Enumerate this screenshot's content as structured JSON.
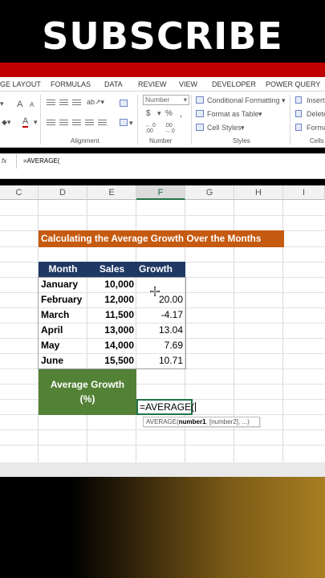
{
  "banner": {
    "title": "SUBSCRIBE"
  },
  "ribbon_tabs": [
    "GE LAYOUT",
    "FORMULAS",
    "DATA",
    "REVIEW",
    "VIEW",
    "DEVELOPER",
    "POWER QUERY"
  ],
  "ribbon": {
    "groups": [
      "Alignment",
      "Number",
      "Styles",
      "Cells"
    ],
    "number_format": "Number",
    "conditional_formatting": "Conditional Formatting",
    "format_as_table": "Format as Table",
    "cell_styles": "Cell Styles",
    "insert": "Insert",
    "delete": "Delete",
    "format": "Format",
    "currency": "$",
    "percent": "%",
    "comma": ",",
    "font_grow": "A",
    "font_shrink": "A",
    "font_color": "A"
  },
  "formula_bar": {
    "fx": "fx",
    "value": "=AVERAGE("
  },
  "columns": [
    "C",
    "D",
    "E",
    "F",
    "G",
    "H",
    "I"
  ],
  "sheet": {
    "title": "Calculating the Average Growth Over the Months",
    "headers": [
      "Month",
      "Sales",
      "Growth"
    ],
    "rows": [
      {
        "month": "January",
        "sales": "10,000",
        "growth": ""
      },
      {
        "month": "February",
        "sales": "12,000",
        "growth": "20.00"
      },
      {
        "month": "March",
        "sales": "11,500",
        "growth": "-4.17"
      },
      {
        "month": "April",
        "sales": "13,000",
        "growth": "13.04"
      },
      {
        "month": "May",
        "sales": "14,000",
        "growth": "7.69"
      },
      {
        "month": "June",
        "sales": "15,500",
        "growth": "10.71"
      }
    ],
    "avg_label_line1": "Average Growth",
    "avg_label_line2": "(%)",
    "editing_value": "=AVERAGE(",
    "tooltip_fn": "AVERAGE(",
    "tooltip_arg1": "number1",
    "tooltip_rest": ", [number2], ...)"
  }
}
